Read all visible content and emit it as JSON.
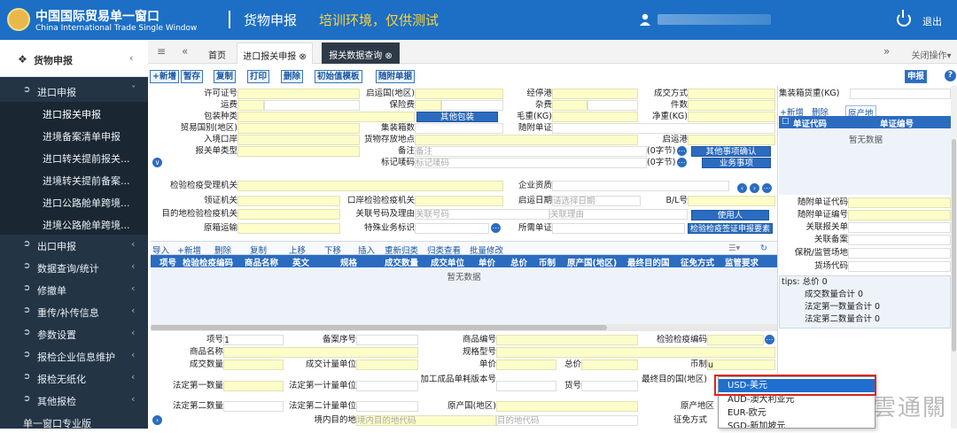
{
  "header": {
    "logo_cn": "中国国际贸易单一窗口",
    "logo_en": "China International Trade Single Window",
    "title": "货物申报",
    "warning": "培训环境，仅供测试",
    "logout": "退出"
  },
  "sidebar": {
    "top": "货物申报",
    "groups": [
      {
        "label": "进口申报"
      },
      {
        "label": "出口申报"
      },
      {
        "label": "数据查询/统计"
      },
      {
        "label": "修撤单"
      },
      {
        "label": "重传/补传信息"
      },
      {
        "label": "参数设置"
      },
      {
        "label": "报检企业信息维护"
      },
      {
        "label": "报检无纸化"
      },
      {
        "label": "其他报检"
      },
      {
        "label": "单一窗口专业版"
      }
    ],
    "subs": [
      {
        "label": "进口报关申报"
      },
      {
        "label": "进境备案清单申报"
      },
      {
        "label": "进口转关提前报关..."
      },
      {
        "label": "进境转关提前备案..."
      },
      {
        "label": "进口公路舱单跨境..."
      },
      {
        "label": "进境公路舱单跨境..."
      }
    ]
  },
  "tabs": {
    "home": "首页",
    "t1": "进口报关申报",
    "t2": "报关数据查询",
    "close_ops": "关闭操作"
  },
  "toolbar": {
    "add": "+新增",
    "save": "暂存",
    "copy": "复制",
    "print": "打印",
    "del": "删除",
    "init": "初始值模板",
    "attach": "随附单据",
    "declare": "申报"
  },
  "form": {
    "l_permit": "许可证号",
    "l_depart": "启运国(地区)",
    "l_via": "经停港",
    "l_trade": "成交方式",
    "l_freight": "运费",
    "l_insur": "保险费",
    "l_misc": "杂费",
    "l_pieces": "件数",
    "l_pack": "包装种类",
    "b_otherpack": "其他包装",
    "l_gross": "毛重(KG)",
    "l_net": "净重(KG)",
    "l_tradecountry": "贸易国别(地区)",
    "l_boxnum": "集装箱数",
    "l_attdoc": "随附单证",
    "l_entryport": "入境口岸",
    "l_goodsplace": "货物存放地点",
    "l_startport": "启运港",
    "l_decltype": "报关单类型",
    "l_remark": "备注",
    "ph_remark": "备注",
    "bytes1": "(0字节)",
    "b_otherconfirm": "其他事项确认",
    "l_mark": "标记唛码",
    "ph_mark": "标记唛码",
    "bytes2": "(0字节)",
    "b_business": "业务事项",
    "l_inspapp": "检验检疫受理机关",
    "l_corpqual": "企业资质",
    "l_collect": "领证机关",
    "l_portinsp": "口岸检验检疫机关",
    "l_startdate": "启运日期",
    "ph_startdate": "请选择日期",
    "l_bl": "B/L号",
    "l_destinsp": "目的地检验检疫机关",
    "l_relno": "关联号码及理由",
    "ph_relno": "关联号码",
    "ph_relreason": "关联理由",
    "b_user": "使用人",
    "l_origship": "原箱运输",
    "l_special": "特殊业务标识",
    "l_reqdoc": "所需单证",
    "b_inspcert": "检验检疫签证申报要素"
  },
  "detail": {
    "toolbar": [
      "导入",
      "+新增",
      "删除",
      "复制",
      "上移",
      "下移",
      "插入",
      "重新归类",
      "归类查看",
      "批量修改"
    ],
    "headers": [
      "项号",
      "检验检疫编码",
      "商品名称",
      "英文",
      "规格",
      "成交数量",
      "成交单位",
      "单价",
      "总价",
      "币制",
      "原产国(地区)",
      "最终目的国",
      "征免方式",
      "监管要求"
    ],
    "empty": "暂无数据"
  },
  "item": {
    "l_no": "项号",
    "v_no": "1",
    "l_record": "备案序号",
    "l_goodsno": "商品编号",
    "l_inspcode": "检验检疫编码",
    "l_name": "商品名称",
    "l_model": "规格型号",
    "l_qty": "成交数量",
    "l_unit": "成交计量单位",
    "l_price": "单价",
    "l_total": "总价",
    "l_curr": "币制",
    "v_curr": "u",
    "l_q1": "法定第一数量",
    "l_u1": "法定第一计量单位",
    "l_version": "加工成品单耗版本号",
    "l_goodsid": "货号",
    "l_finaldest": "最终目的国(地区)",
    "l_q2": "法定第二数量",
    "l_u2": "法定第二计量单位",
    "l_origin": "原产国(地区)",
    "l_origarea": "原产地区",
    "l_domestic": "境内目的地",
    "ph_domestic": "境内目的地代码",
    "ph_destcode": "目的地代码",
    "l_exempt": "征免方式"
  },
  "right": {
    "l_boxweight": "集装箱货重(KG)",
    "add": "+新增",
    "del": "删除",
    "origin": "原产地",
    "h_code": "单证代码",
    "h_no": "单证编号",
    "empty": "暂无数据",
    "l_attcode": "随附单证代码",
    "l_attno": "随附单证编号",
    "l_relcust": "关联报关单",
    "l_relrec": "关联备案",
    "l_bonded": "保税/监管场地",
    "l_cargocode": "货场代码",
    "tips": "tips: 总价 0",
    "sum1": "成交数量合计 0",
    "sum2": "法定第一数量合计 0",
    "sum3": "法定第二数量合计 0"
  },
  "dropdown": {
    "items": [
      "USD-美元",
      "AUD-澳大利亚元",
      "EUR-欧元",
      "SGD-新加坡元"
    ]
  },
  "watermark": "雲通關"
}
